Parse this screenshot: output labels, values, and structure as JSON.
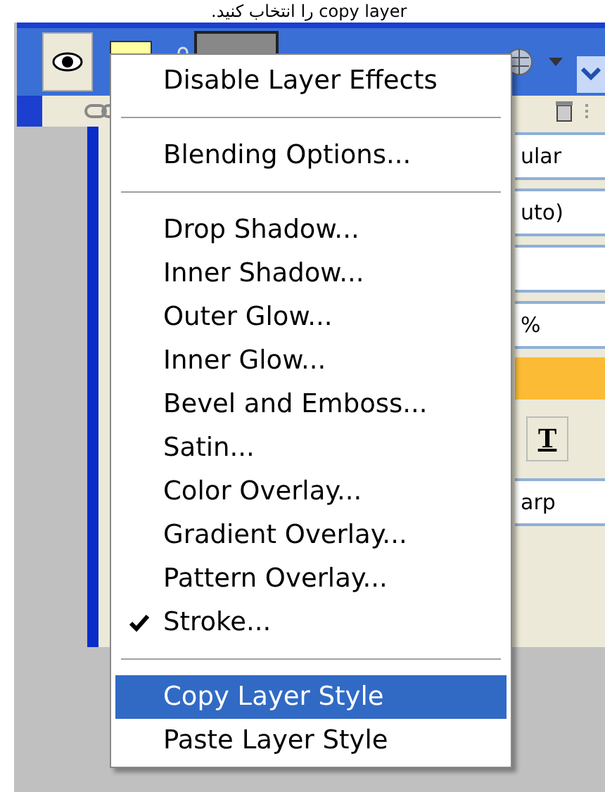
{
  "caption": "copy layer را انتخاب کنید.",
  "layer_row": {
    "selected": true
  },
  "side_fields": [
    "ular",
    "uto)",
    "%"
  ],
  "side_button": "T",
  "side_field_last": "arp",
  "context_menu": [
    {
      "kind": "item",
      "label": "Disable Layer Effects",
      "checked": false,
      "selected": false
    },
    {
      "kind": "separator"
    },
    {
      "kind": "item",
      "label": "Blending Options...",
      "checked": false,
      "selected": false
    },
    {
      "kind": "separator"
    },
    {
      "kind": "item",
      "label": "Drop Shadow...",
      "checked": false,
      "selected": false
    },
    {
      "kind": "item",
      "label": "Inner Shadow...",
      "checked": false,
      "selected": false
    },
    {
      "kind": "item",
      "label": "Outer Glow...",
      "checked": false,
      "selected": false
    },
    {
      "kind": "item",
      "label": "Inner Glow...",
      "checked": false,
      "selected": false
    },
    {
      "kind": "item",
      "label": "Bevel and Emboss...",
      "checked": false,
      "selected": false
    },
    {
      "kind": "item",
      "label": "Satin...",
      "checked": false,
      "selected": false
    },
    {
      "kind": "item",
      "label": "Color Overlay...",
      "checked": false,
      "selected": false
    },
    {
      "kind": "item",
      "label": "Gradient Overlay...",
      "checked": false,
      "selected": false
    },
    {
      "kind": "item",
      "label": "Pattern Overlay...",
      "checked": false,
      "selected": false
    },
    {
      "kind": "item",
      "label": "Stroke...",
      "checked": true,
      "selected": false
    },
    {
      "kind": "separator"
    },
    {
      "kind": "item",
      "label": "Copy Layer Style",
      "checked": false,
      "selected": true
    },
    {
      "kind": "item",
      "label": "Paste Layer Style",
      "checked": false,
      "selected": false
    }
  ]
}
